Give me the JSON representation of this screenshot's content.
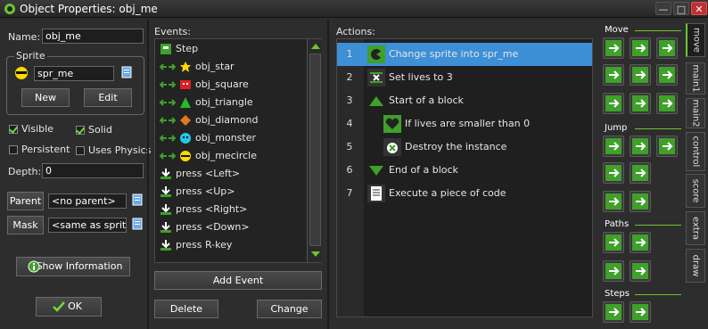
{
  "window": {
    "title": "Object Properties: obj_me",
    "min": "—",
    "max": "□",
    "close": "✕"
  },
  "left": {
    "name_label": "Name:",
    "name_value": "obj_me",
    "sprite_group": "Sprite",
    "sprite_value": "spr_me",
    "new_label": "New",
    "edit_label": "Edit",
    "visible_label": "Visible",
    "solid_label": "Solid",
    "persistent_label": "Persistent",
    "physics_label": "Uses Physics",
    "depth_label": "Depth:",
    "depth_value": "0",
    "parent_label": "Parent",
    "parent_value": "<no parent>",
    "mask_label": "Mask",
    "mask_value": "<same as sprite>",
    "info_label": "Show Information",
    "ok_label": "OK"
  },
  "events": {
    "header": "Events:",
    "items": [
      {
        "label": "Step",
        "icon": "step-icon"
      },
      {
        "label": "obj_star",
        "icon": "star-collision-icon"
      },
      {
        "label": "obj_square",
        "icon": "square-collision-icon"
      },
      {
        "label": "obj_triangle",
        "icon": "triangle-collision-icon"
      },
      {
        "label": "obj_diamond",
        "icon": "diamond-collision-icon"
      },
      {
        "label": "obj_monster",
        "icon": "monster-collision-icon"
      },
      {
        "label": "obj_mecircle",
        "icon": "mecircle-collision-icon"
      },
      {
        "label": "press <Left>",
        "icon": "key-press-icon"
      },
      {
        "label": "press <Up>",
        "icon": "key-press-icon"
      },
      {
        "label": "press <Right>",
        "icon": "key-press-icon"
      },
      {
        "label": "press <Down>",
        "icon": "key-press-icon"
      },
      {
        "label": "press R-key",
        "icon": "key-press-icon"
      }
    ],
    "add_label": "Add Event",
    "delete_label": "Delete",
    "change_label": "Change"
  },
  "actions": {
    "header": "Actions:",
    "items": [
      {
        "num": "1",
        "label": "Change sprite into spr_me",
        "icon": "change-sprite-icon"
      },
      {
        "num": "2",
        "label": "Set lives to 3",
        "icon": "set-lives-icon"
      },
      {
        "num": "3",
        "label": "Start of a block",
        "icon": "start-block-icon"
      },
      {
        "num": "4",
        "label": "If lives are smaller than 0",
        "icon": "test-lives-icon"
      },
      {
        "num": "5",
        "label": "Destroy the instance",
        "icon": "destroy-icon"
      },
      {
        "num": "6",
        "label": "End of a block",
        "icon": "end-block-icon"
      },
      {
        "num": "7",
        "label": "Execute a piece of code",
        "icon": "code-icon"
      }
    ]
  },
  "library": {
    "groups": [
      "Move",
      "Jump",
      "Paths",
      "Steps"
    ],
    "tabs": [
      "move",
      "main1",
      "main2",
      "control",
      "score",
      "extra",
      "draw"
    ]
  },
  "colors": {
    "accent": "#6fc431",
    "selection": "#3d8fd6",
    "icon_green": "#3fa02a"
  }
}
